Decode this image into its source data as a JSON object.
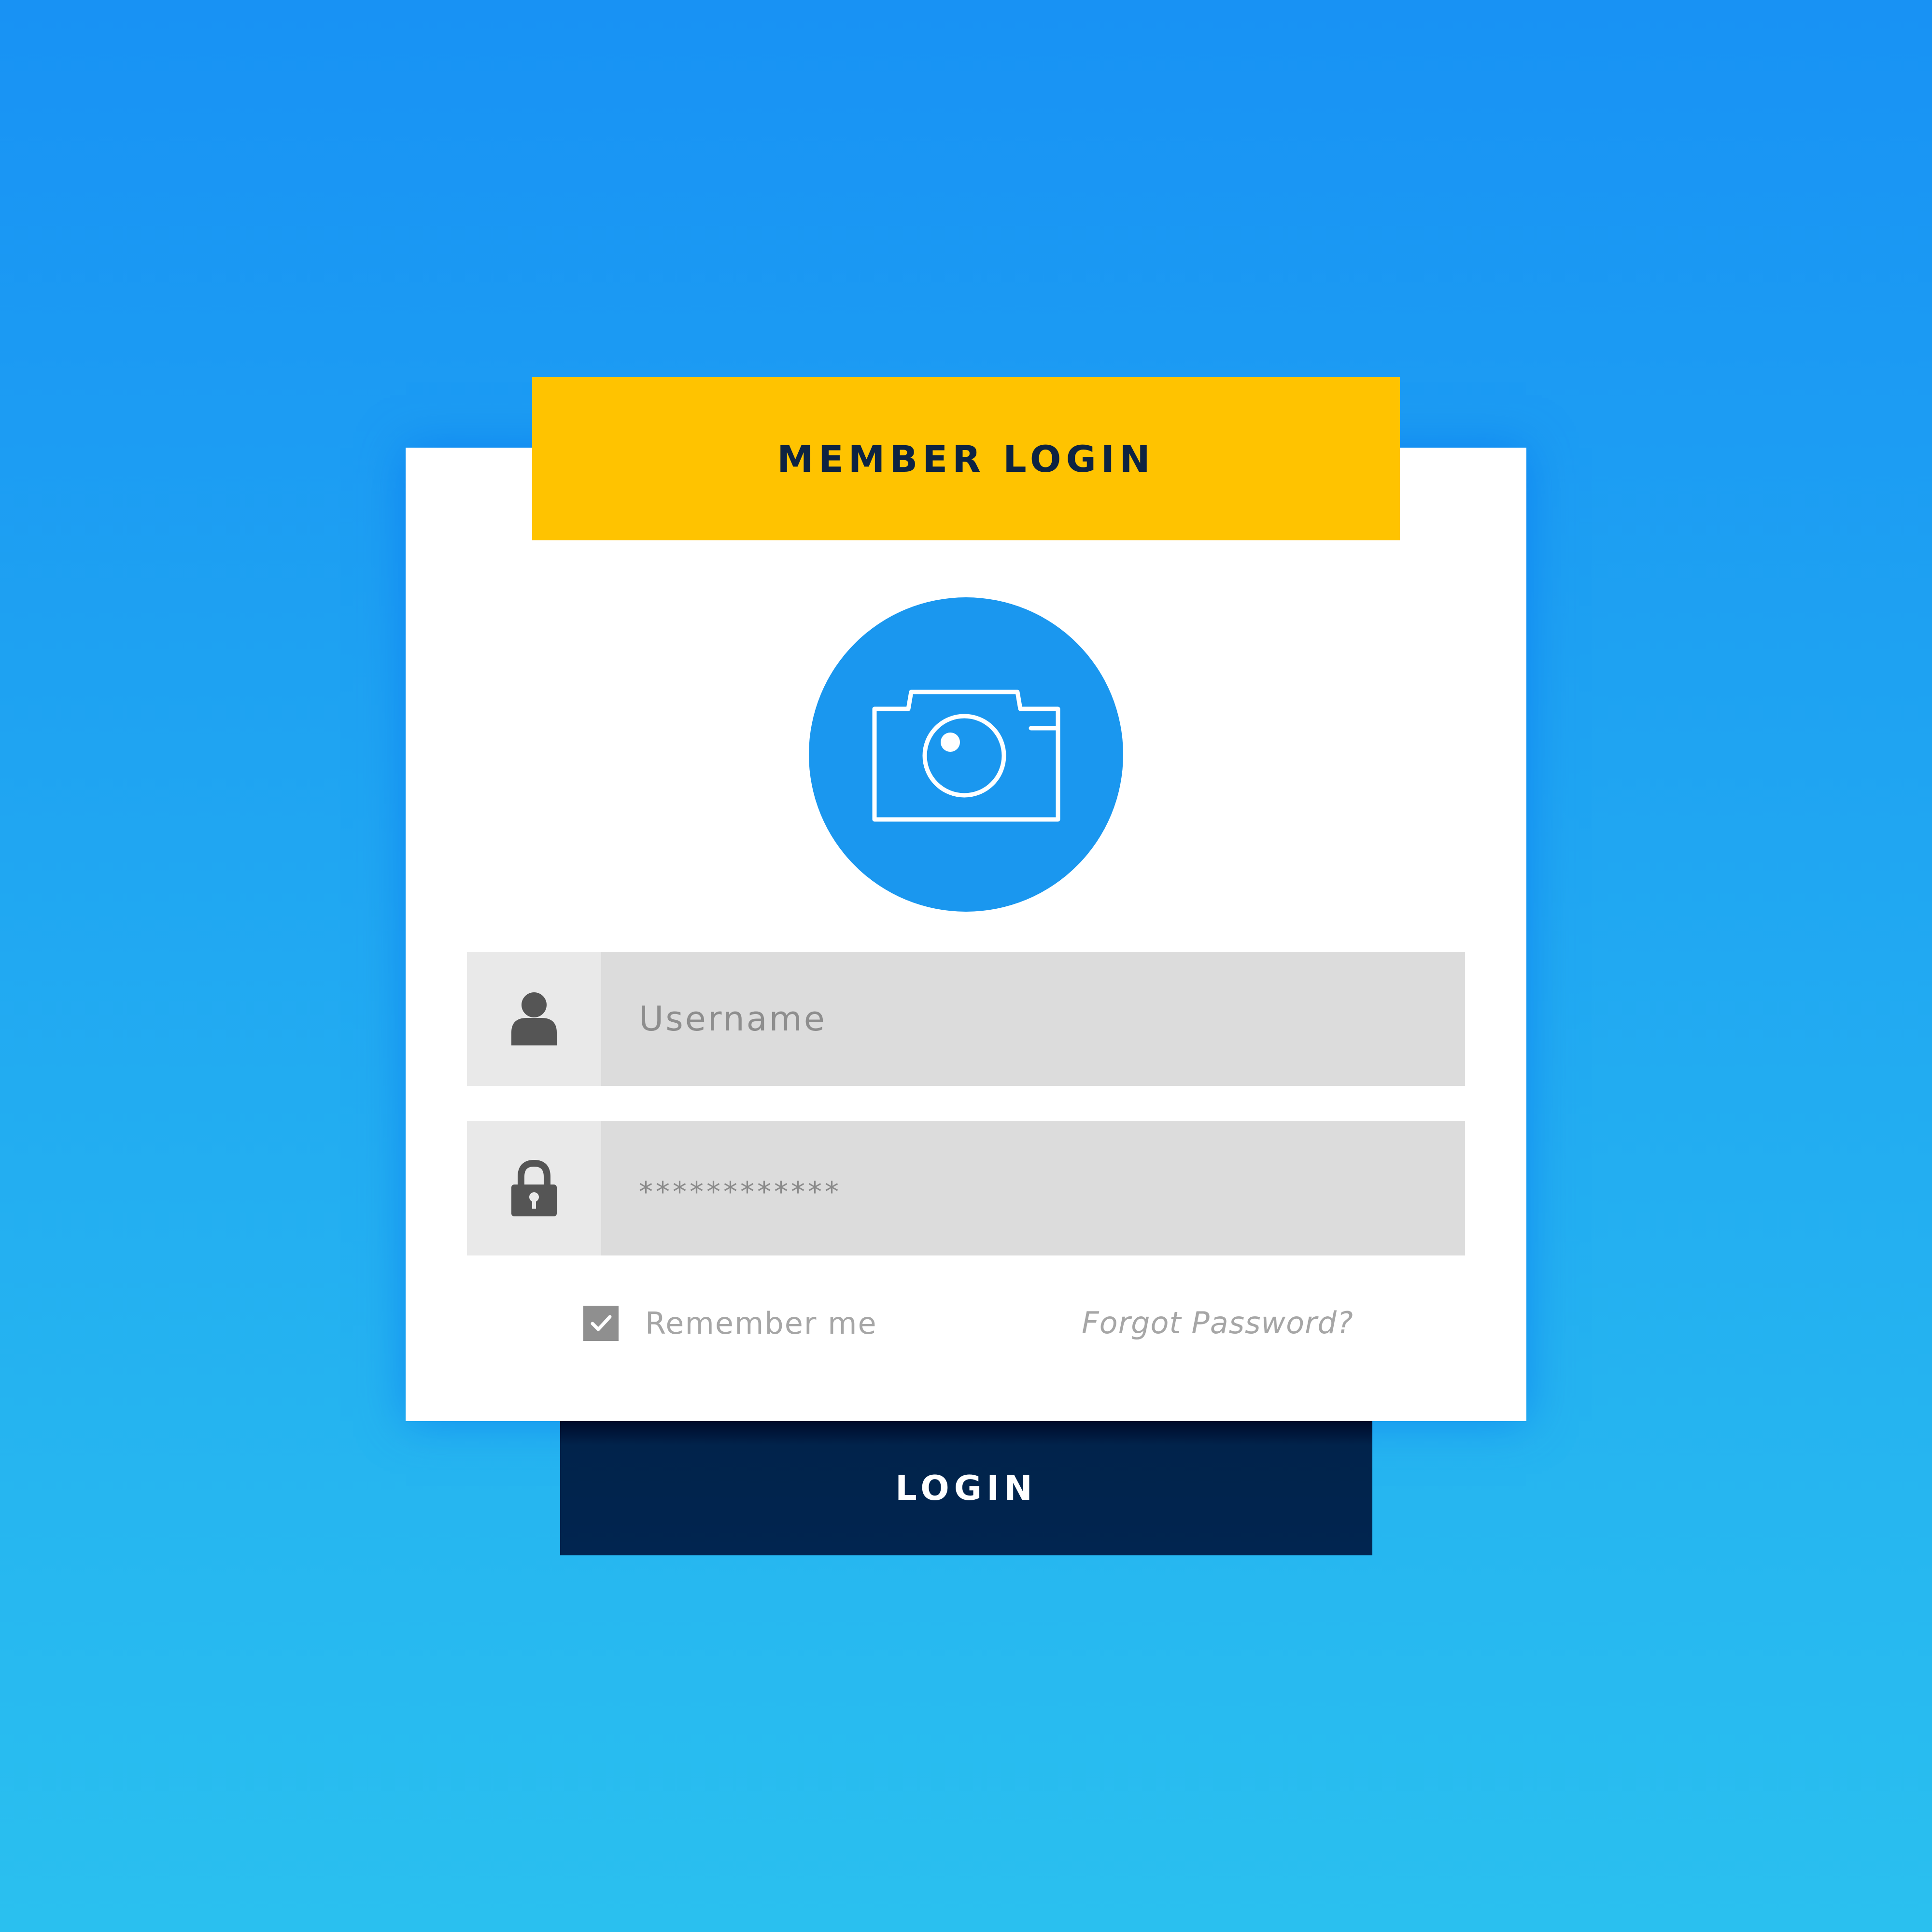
{
  "login_panel": {
    "title": "MEMBER LOGIN",
    "avatar_icon": "camera-icon",
    "username_field": {
      "icon": "user-icon",
      "placeholder": "Username",
      "value": ""
    },
    "password_field": {
      "icon": "lock-icon",
      "value": "************"
    },
    "remember_me": {
      "label": "Remember me",
      "checked": true
    },
    "forgot_password_label": "Forgot Password?",
    "login_button_label": "LOGIN"
  },
  "colors": {
    "background_top": "#1892f4",
    "background_bottom": "#2ac0ef",
    "header_accent": "#ffc300",
    "avatar_circle": "#1a97ef",
    "button_dark": "#012550",
    "title_text": "#0d2342"
  }
}
